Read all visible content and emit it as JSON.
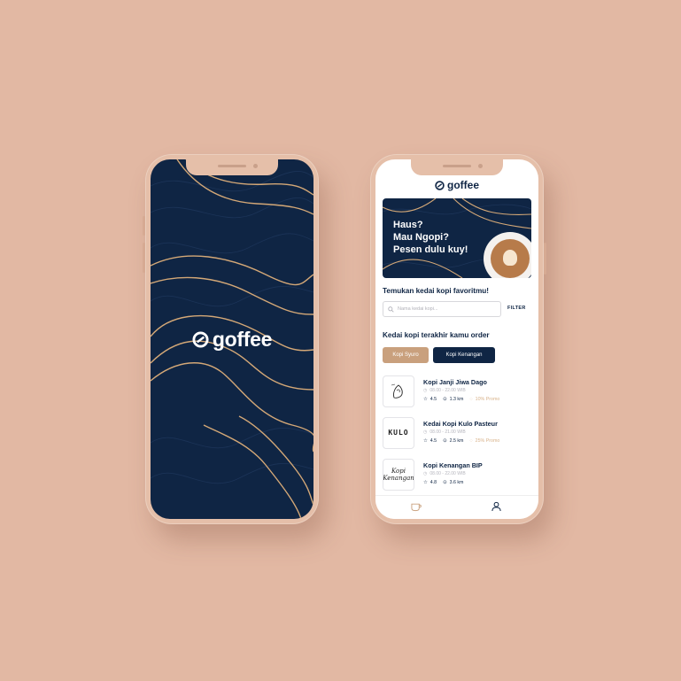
{
  "brand": {
    "name": "goffee",
    "navy": "#0f2544",
    "gold": "#c9a07d",
    "background": "#e2b8a3"
  },
  "banner": {
    "lines": [
      "Haus?",
      "Mau Ngopi?",
      "Pesen dulu kuy!"
    ]
  },
  "search_section": {
    "title": "Temukan kedai kopi favoritmu!",
    "placeholder": "Nama kedai kopi...",
    "filter_label": "FILTER"
  },
  "recent_section": {
    "title": "Kedai kopi terakhir kamu order",
    "chips": [
      "Kopi Syuro",
      "Kopi Kenangan"
    ]
  },
  "shops": [
    {
      "name": "Kopi Janji Jiwa Dago",
      "hours": "08.00 - 22.00 WIB",
      "rating": "4.5",
      "distance": "1.3 km",
      "promo": "10% Promo",
      "logo_text": "Janji Jiwa"
    },
    {
      "name": "Kedai Kopi Kulo Pasteur",
      "hours": "08.00 - 21.00 WIB",
      "rating": "4.5",
      "distance": "2.5 km",
      "promo": "25% Promo",
      "logo_text": "KULO"
    },
    {
      "name": "Kopi Kenangan BIP",
      "hours": "08.00 - 22.00 WIB",
      "rating": "4.8",
      "distance": "3.6 km",
      "promo": "",
      "logo_text": "Kopi Kenangan"
    }
  ],
  "tabbar": {
    "items": [
      "coffee-cup-icon",
      "profile-icon"
    ]
  }
}
